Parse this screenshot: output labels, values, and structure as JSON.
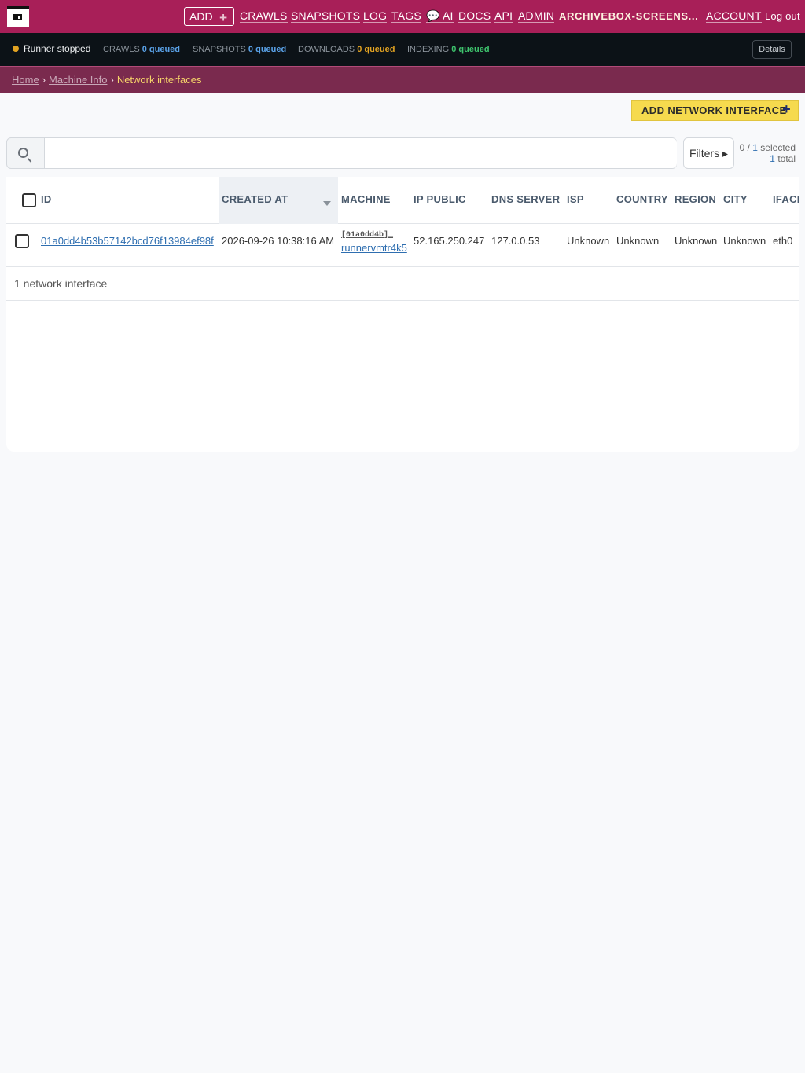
{
  "nav": {
    "add_label": "ADD",
    "add_plus": "➕",
    "crawls": "CRAWLS",
    "snapshots": "SNAPSHOTS",
    "log": "LOG",
    "tags": "TAGS",
    "ai": "💬 AI",
    "docs": "DOCS",
    "api": "API",
    "admin": "ADMIN",
    "site": "ARCHIVEBOX-SCREENS...",
    "account": "ACCOUNT",
    "logout": "Log out"
  },
  "status": {
    "runner": "Runner stopped",
    "crawls_label": "CRAWLS",
    "crawls_value": "0 queued",
    "snapshots_label": "SNAPSHOTS",
    "snapshots_value": "0 queued",
    "downloads_label": "DOWNLOADS",
    "downloads_value": "0 queued",
    "indexing_label": "INDEXING",
    "indexing_value": "0 queued",
    "details": "Details",
    "colors": {
      "runner_dot": "#e2a322",
      "crawls": "#5aa2e8",
      "snapshots": "#5aa2e8",
      "downloads": "#e2a322",
      "indexing": "#3ec46d"
    }
  },
  "breadcrumb": {
    "home": "Home",
    "sep": "›",
    "machine_info": "Machine Info",
    "current": "Network interfaces"
  },
  "actions": {
    "add_interface": "ADD NETWORK INTERFACE",
    "add_plus": "+"
  },
  "search": {
    "placeholder": "",
    "filters": "Filters ▸",
    "selected_prefix": "0 / ",
    "selected_link": "1",
    "selected_suffix": " selected",
    "total_link": "1",
    "total_suffix": " total"
  },
  "table": {
    "headers": {
      "id": "ID",
      "created_at": "CREATED AT",
      "machine": "MACHINE",
      "ip_public": "IP PUBLIC",
      "dns_server": "DNS SERVER",
      "isp": "ISP",
      "country": "COUNTRY",
      "region": "REGION",
      "city": "CITY",
      "iface": "IFACE"
    },
    "rows": [
      {
        "id": "01a0dd4b53b57142bcd76f13984ef98f",
        "created_at": "2026-09-26 10:38:16 AM",
        "machine_id": "[01a0dd4b]_",
        "machine_host": "runnervmtr4k5",
        "ip_public": "52.165.250.247",
        "dns_server": "127.0.0.53",
        "isp": "Unknown",
        "country": "Unknown",
        "region": "Unknown",
        "city": "Unknown",
        "iface": "eth0"
      }
    ],
    "count_text": "1 network interface"
  }
}
